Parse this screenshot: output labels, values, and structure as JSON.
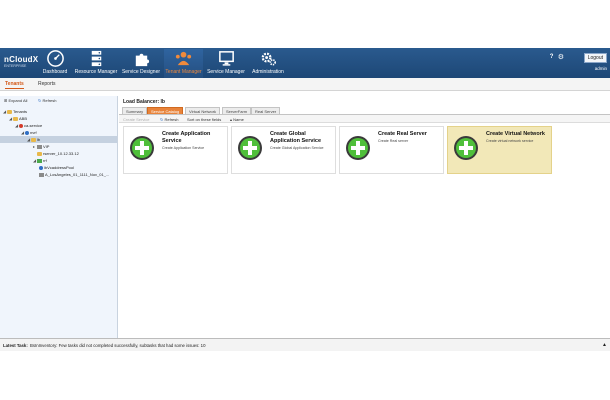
{
  "brand": {
    "name": "nCloudX",
    "sub": "ENTERPRISE"
  },
  "nav": [
    {
      "label": "Dashboard",
      "icon": "dashboard-gauge-icon"
    },
    {
      "label": "Resource Manager",
      "icon": "server-stack-icon"
    },
    {
      "label": "Service Designer",
      "icon": "puzzle-icon"
    },
    {
      "label": "Tenant Manager",
      "icon": "users-icon"
    },
    {
      "label": "Service Manager",
      "icon": "monitor-icon"
    },
    {
      "label": "Administration",
      "icon": "gears-icon"
    }
  ],
  "top_right": {
    "help": "?",
    "logout": "Logout",
    "user": "admin"
  },
  "subtabs": [
    "Tenants",
    "Reports"
  ],
  "tree_toolbar": {
    "expand_all": "Expand All",
    "refresh": "Refresh"
  },
  "tree": [
    {
      "label": "Tenants"
    },
    {
      "label": "ABB"
    },
    {
      "label": "ca-service"
    },
    {
      "label": "nvrf"
    },
    {
      "label": "lb"
    },
    {
      "label": "VIP"
    },
    {
      "label": "rserver_10.12.33.12"
    },
    {
      "label": "rrf"
    },
    {
      "label": "lbVcaddressPool"
    },
    {
      "label": "A_LosAngeles_01_1111_Nov_01_..."
    }
  ],
  "main": {
    "title": "Load Balancer: lb",
    "tabs": [
      "Summary",
      "Service Catalog",
      "Virtual Network",
      "ServerFarm",
      "Real Server"
    ],
    "toolbar": {
      "create": "Create Service",
      "refresh": "Refresh",
      "sort": "Sort on these fields",
      "name": "Name"
    },
    "cards": [
      {
        "title": "Create Application Service",
        "desc": "Create Application Service"
      },
      {
        "title": "Create Global Application Service",
        "desc": "Create Global Application Service"
      },
      {
        "title": "Create Real Server",
        "desc": "Create Real server"
      },
      {
        "title": "Create Virtual Network",
        "desc": "Create virtual network service"
      }
    ]
  },
  "status": {
    "label": "Latest Task:",
    "text": "BsInInventory: Few tasks did not completed successfully, subtasks that had some issues: 10",
    "arrow": "▲"
  },
  "colors": {
    "header": "#1d4776",
    "accent": "#e8833a",
    "highlight_card": "#f2e8b8",
    "plus_green": "#4fbf3a"
  }
}
